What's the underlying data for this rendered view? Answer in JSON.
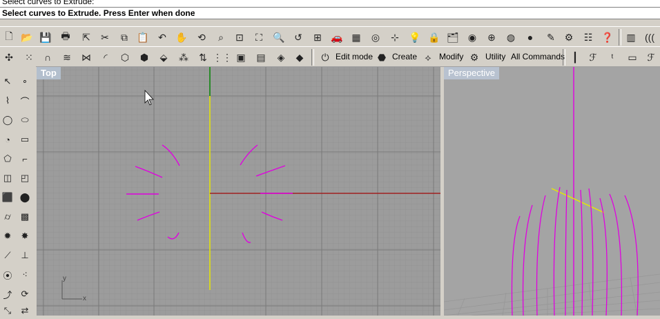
{
  "command": {
    "history_line": "Select curves to Extrude:",
    "prompt_text": "Select curves to Extrude. Press Enter when done",
    "prompt_value": ":"
  },
  "toolbar_tabs": {
    "edit_mode": "Edit mode",
    "create": "Create",
    "modify": "Modify",
    "utility": "Utility",
    "all_commands": "All Commands"
  },
  "viewports": {
    "top_title": "Top",
    "perspective_title": "Perspective",
    "axis_x": "x",
    "axis_y": "y"
  },
  "colors": {
    "curve": "#e000e0",
    "x_axis": "#a02020",
    "y_axis": "#e8e800",
    "grid_minor": "#8e8e8e",
    "grid_major": "#7a7a7a"
  }
}
